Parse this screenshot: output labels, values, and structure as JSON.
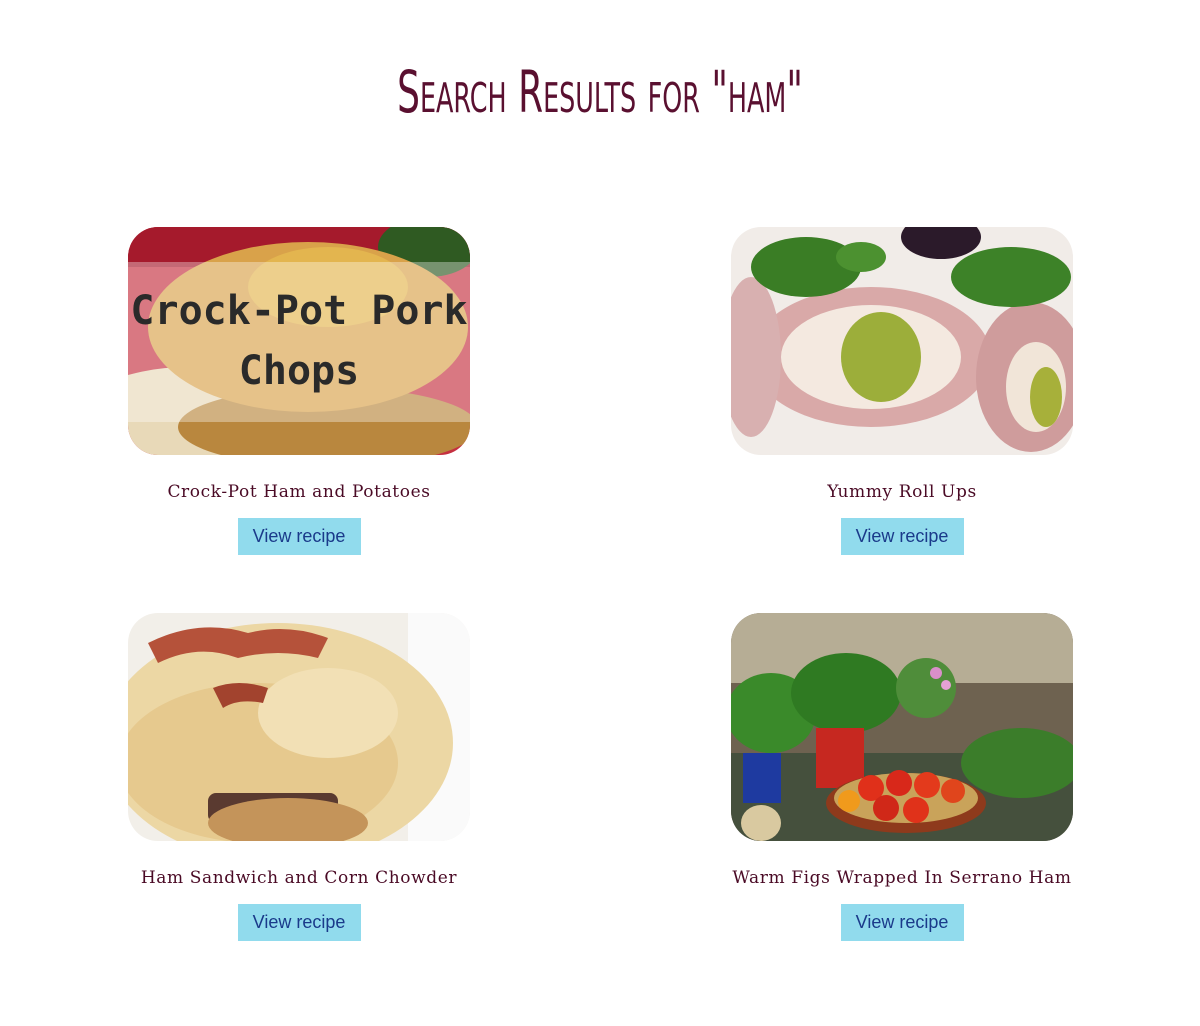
{
  "page": {
    "title": "Search Results for \"ham\""
  },
  "results": [
    {
      "title": "Crock-Pot Ham and Potatoes",
      "image_text": [
        "Crock-Pot Pork",
        "Chops"
      ],
      "button_label": "View recipe"
    },
    {
      "title": "Yummy Roll Ups",
      "button_label": "View recipe"
    },
    {
      "title": "Ham Sandwich and Corn Chowder",
      "button_label": "View recipe"
    },
    {
      "title": "Warm Figs Wrapped In Serrano Ham",
      "button_label": "View recipe"
    }
  ],
  "colors": {
    "title": "#5a1030",
    "card_title": "#4a0a25",
    "button_bg": "#91dbed",
    "button_text": "#1a3a8a"
  }
}
